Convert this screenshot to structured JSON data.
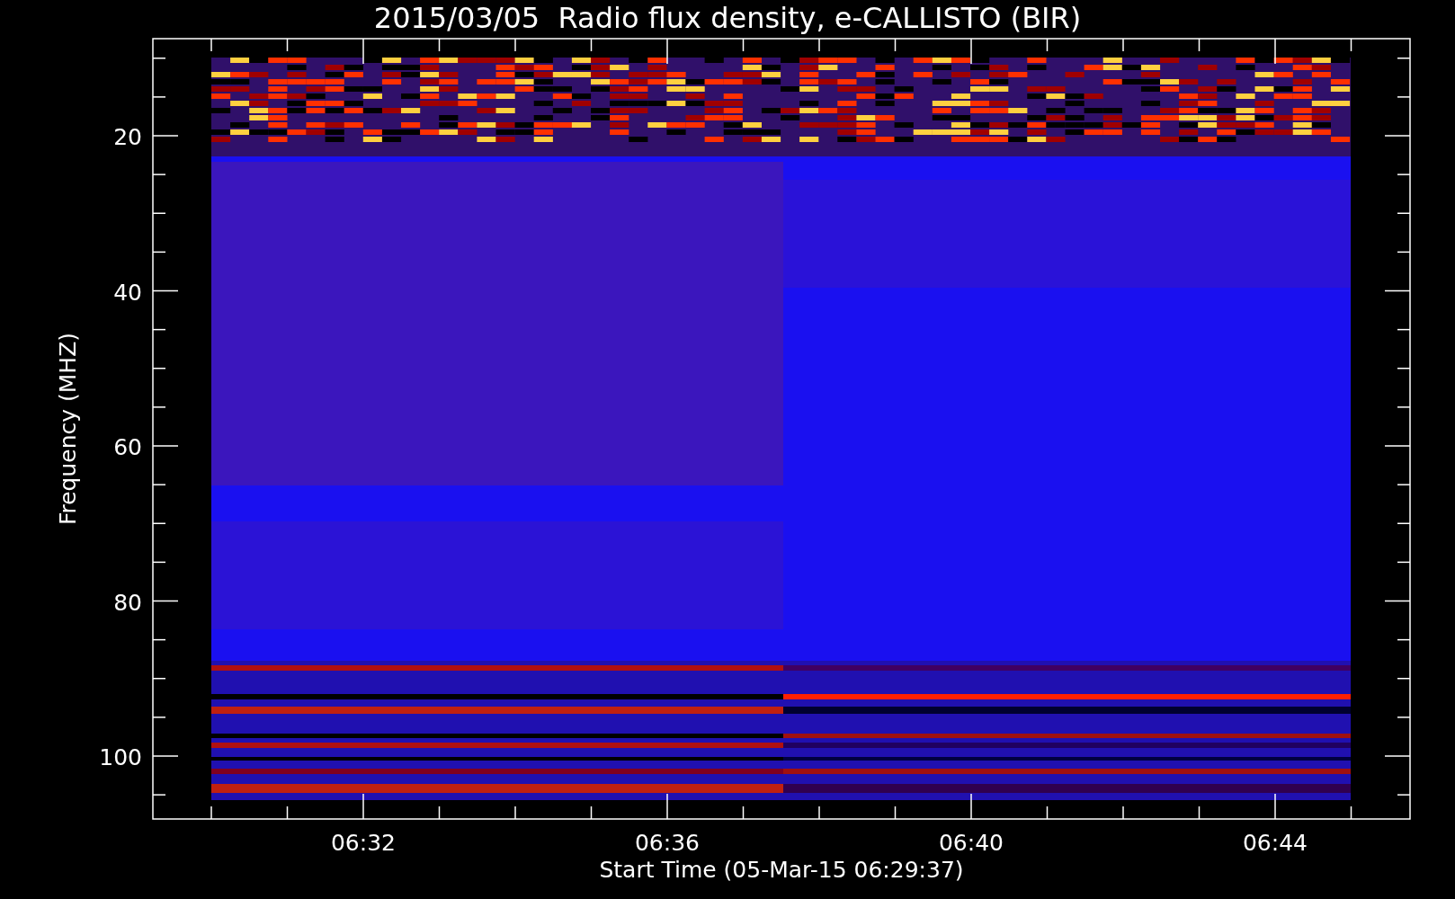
{
  "title": "2015/03/05  Radio flux density, e-CALLISTO (BIR)",
  "y_axis": {
    "label": "Frequency (MHZ)",
    "ticks": [
      "20",
      "40",
      "60",
      "80",
      "100"
    ]
  },
  "x_axis": {
    "label": "Start Time (05-Mar-15 06:29:37)",
    "ticks": [
      "06:32",
      "06:36",
      "06:40",
      "06:44"
    ]
  }
}
